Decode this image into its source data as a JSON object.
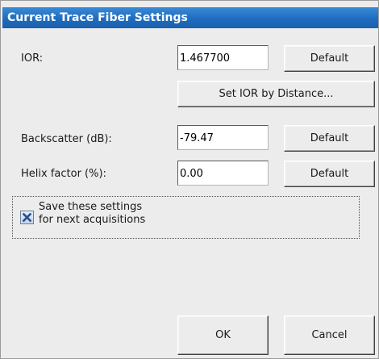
{
  "window": {
    "title": "Current Trace Fiber Settings"
  },
  "ior": {
    "label": "IOR:",
    "value": "1.467700",
    "default_label": "Default",
    "set_by_distance_label": "Set IOR by Distance..."
  },
  "backscatter": {
    "label": "Backscatter (dB):",
    "value": "-79.47",
    "default_label": "Default"
  },
  "helix": {
    "label": "Helix factor (%):",
    "value": "0.00",
    "default_label": "Default"
  },
  "save_settings": {
    "checked": true,
    "label_line1": "Save these settings",
    "label_line2": "for next acquisitions",
    "icon": "x-mark-icon",
    "check_color": "#2a4e86"
  },
  "actions": {
    "ok_label": "OK",
    "cancel_label": "Cancel"
  }
}
